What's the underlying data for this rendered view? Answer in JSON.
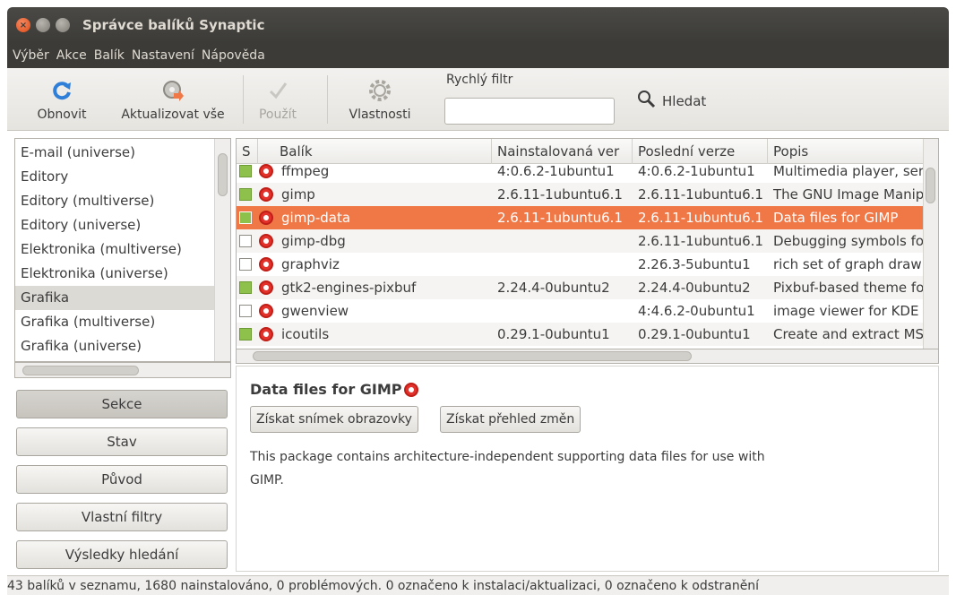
{
  "window": {
    "title": "Správce balíků Synaptic"
  },
  "menubar": [
    "Výběr",
    "Akce",
    "Balík",
    "Nastavení",
    "Nápověda"
  ],
  "toolbar": {
    "reload": "Obnovit",
    "upgrade_all": "Aktualizovat vše",
    "apply": "Použít",
    "properties": "Vlastnosti",
    "quick_filter_label": "Rychlý filtr",
    "quick_filter_value": "",
    "search": "Hledat"
  },
  "sections": [
    "E-mail (universe)",
    "Editory",
    "Editory (multiverse)",
    "Editory (universe)",
    "Elektronika (multiverse)",
    "Elektronika (universe)",
    "Grafika",
    "Grafika (multiverse)",
    "Grafika (universe)"
  ],
  "selected_section": "Grafika",
  "filter_buttons": [
    "Sekce",
    "Stav",
    "Původ",
    "Vlastní filtry",
    "Výsledky hledání"
  ],
  "active_filter": "Sekce",
  "table": {
    "headers": [
      "S",
      "Balík",
      "Nainstalovaná ver",
      "Poslední verze",
      "Popis"
    ],
    "rows": [
      {
        "installed": true,
        "name": "ffmpeg",
        "installed_version": "4:0.6.2-1ubuntu1",
        "latest_version": "4:0.6.2-1ubuntu1",
        "description": "Multimedia player, serv"
      },
      {
        "installed": true,
        "name": "gimp",
        "installed_version": "2.6.11-1ubuntu6.1",
        "latest_version": "2.6.11-1ubuntu6.1",
        "description": "The GNU Image Manipu"
      },
      {
        "installed": true,
        "name": "gimp-data",
        "installed_version": "2.6.11-1ubuntu6.1",
        "latest_version": "2.6.11-1ubuntu6.1",
        "description": "Data files for GIMP",
        "selected": true
      },
      {
        "installed": false,
        "name": "gimp-dbg",
        "installed_version": "",
        "latest_version": "2.6.11-1ubuntu6.1",
        "description": "Debugging symbols for"
      },
      {
        "installed": false,
        "name": "graphviz",
        "installed_version": "",
        "latest_version": "2.26.3-5ubuntu1",
        "description": "rich set of graph drawi"
      },
      {
        "installed": true,
        "name": "gtk2-engines-pixbuf",
        "installed_version": "2.24.4-0ubuntu2",
        "latest_version": "2.24.4-0ubuntu2",
        "description": "Pixbuf-based theme fo"
      },
      {
        "installed": false,
        "name": "gwenview",
        "installed_version": "",
        "latest_version": "4:4.6.2-0ubuntu1",
        "description": "image viewer for KDE"
      },
      {
        "installed": true,
        "name": "icoutils",
        "installed_version": "0.29.1-0ubuntu1",
        "latest_version": "0.29.1-0ubuntu1",
        "description": "Create and extract MS"
      }
    ]
  },
  "detail": {
    "title": "Data files for GIMP",
    "screenshot_button": "Získat snímek obrazovky",
    "changelog_button": "Získat přehled změn",
    "description": "This package contains architecture-independent supporting data files for use with GIMP."
  },
  "status": "43 balíků v seznamu, 1680 nainstalováno, 0 problémových. 0 označeno k instalaci/aktualizaci, 0 označeno k odstranění",
  "colors": {
    "selection": "#f07746",
    "titlebar": "#3c3b37",
    "installed": "#8ec14c",
    "status_icon": "#e2322b"
  }
}
